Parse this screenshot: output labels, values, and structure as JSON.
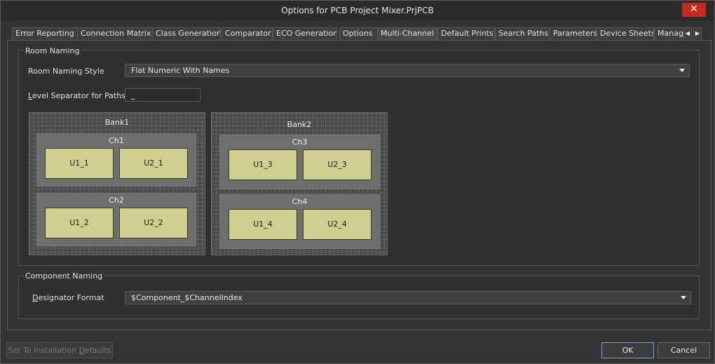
{
  "window": {
    "title": "Options for PCB Project Mixer.PrjPCB",
    "close_glyph": "✕"
  },
  "tabs": [
    {
      "label": "Error Reporting"
    },
    {
      "label": "Connection Matrix"
    },
    {
      "label": "Class Generation"
    },
    {
      "label": "Comparator"
    },
    {
      "label": "ECO Generation"
    },
    {
      "label": "Options"
    },
    {
      "label": "Multi-Channel",
      "active": true
    },
    {
      "label": "Default Prints"
    },
    {
      "label": "Search Paths"
    },
    {
      "label": "Parameters"
    },
    {
      "label": "Device Sheets"
    },
    {
      "label": "Manag"
    }
  ],
  "tab_scroll": {
    "left": "◀",
    "right": "▶"
  },
  "room_naming": {
    "group_title": "Room Naming",
    "style_label": "Room Naming Style",
    "style_value": "Flat Numeric With Names",
    "separator_label_prefix": "",
    "separator_label_underlined": "L",
    "separator_label_rest": "evel Separator for Paths",
    "separator_value": "_"
  },
  "diagram": {
    "banks": [
      {
        "label": "Bank1",
        "channels": [
          {
            "label": "Ch1",
            "components": [
              "U1_1",
              "U2_1"
            ]
          },
          {
            "label": "Ch2",
            "components": [
              "U1_2",
              "U2_2"
            ]
          }
        ]
      },
      {
        "label": "Bank2",
        "channels": [
          {
            "label": "Ch3",
            "components": [
              "U1_3",
              "U2_3"
            ]
          },
          {
            "label": "Ch4",
            "components": [
              "U1_4",
              "U2_4"
            ]
          }
        ]
      }
    ]
  },
  "component_naming": {
    "group_title": "Component Naming",
    "designator_label_underlined": "D",
    "designator_label_rest": "esignator Format",
    "designator_value": "$Component_$ChannelIndex"
  },
  "footer": {
    "defaults_prefix": "Set To Installation ",
    "defaults_underlined": "D",
    "defaults_rest": "efaults",
    "ok_label": "OK",
    "cancel_label": "Cancel"
  }
}
